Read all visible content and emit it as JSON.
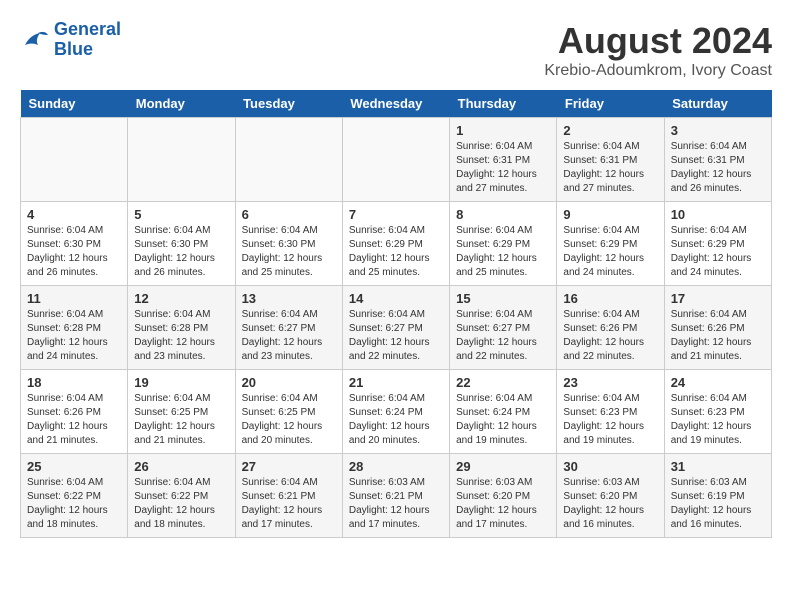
{
  "header": {
    "logo_line1": "General",
    "logo_line2": "Blue",
    "month_year": "August 2024",
    "location": "Krebio-Adoumkrom, Ivory Coast"
  },
  "weekdays": [
    "Sunday",
    "Monday",
    "Tuesday",
    "Wednesday",
    "Thursday",
    "Friday",
    "Saturday"
  ],
  "weeks": [
    [
      {
        "day": "",
        "info": ""
      },
      {
        "day": "",
        "info": ""
      },
      {
        "day": "",
        "info": ""
      },
      {
        "day": "",
        "info": ""
      },
      {
        "day": "1",
        "info": "Sunrise: 6:04 AM\nSunset: 6:31 PM\nDaylight: 12 hours\nand 27 minutes."
      },
      {
        "day": "2",
        "info": "Sunrise: 6:04 AM\nSunset: 6:31 PM\nDaylight: 12 hours\nand 27 minutes."
      },
      {
        "day": "3",
        "info": "Sunrise: 6:04 AM\nSunset: 6:31 PM\nDaylight: 12 hours\nand 26 minutes."
      }
    ],
    [
      {
        "day": "4",
        "info": "Sunrise: 6:04 AM\nSunset: 6:30 PM\nDaylight: 12 hours\nand 26 minutes."
      },
      {
        "day": "5",
        "info": "Sunrise: 6:04 AM\nSunset: 6:30 PM\nDaylight: 12 hours\nand 26 minutes."
      },
      {
        "day": "6",
        "info": "Sunrise: 6:04 AM\nSunset: 6:30 PM\nDaylight: 12 hours\nand 25 minutes."
      },
      {
        "day": "7",
        "info": "Sunrise: 6:04 AM\nSunset: 6:29 PM\nDaylight: 12 hours\nand 25 minutes."
      },
      {
        "day": "8",
        "info": "Sunrise: 6:04 AM\nSunset: 6:29 PM\nDaylight: 12 hours\nand 25 minutes."
      },
      {
        "day": "9",
        "info": "Sunrise: 6:04 AM\nSunset: 6:29 PM\nDaylight: 12 hours\nand 24 minutes."
      },
      {
        "day": "10",
        "info": "Sunrise: 6:04 AM\nSunset: 6:29 PM\nDaylight: 12 hours\nand 24 minutes."
      }
    ],
    [
      {
        "day": "11",
        "info": "Sunrise: 6:04 AM\nSunset: 6:28 PM\nDaylight: 12 hours\nand 24 minutes."
      },
      {
        "day": "12",
        "info": "Sunrise: 6:04 AM\nSunset: 6:28 PM\nDaylight: 12 hours\nand 23 minutes."
      },
      {
        "day": "13",
        "info": "Sunrise: 6:04 AM\nSunset: 6:27 PM\nDaylight: 12 hours\nand 23 minutes."
      },
      {
        "day": "14",
        "info": "Sunrise: 6:04 AM\nSunset: 6:27 PM\nDaylight: 12 hours\nand 22 minutes."
      },
      {
        "day": "15",
        "info": "Sunrise: 6:04 AM\nSunset: 6:27 PM\nDaylight: 12 hours\nand 22 minutes."
      },
      {
        "day": "16",
        "info": "Sunrise: 6:04 AM\nSunset: 6:26 PM\nDaylight: 12 hours\nand 22 minutes."
      },
      {
        "day": "17",
        "info": "Sunrise: 6:04 AM\nSunset: 6:26 PM\nDaylight: 12 hours\nand 21 minutes."
      }
    ],
    [
      {
        "day": "18",
        "info": "Sunrise: 6:04 AM\nSunset: 6:26 PM\nDaylight: 12 hours\nand 21 minutes."
      },
      {
        "day": "19",
        "info": "Sunrise: 6:04 AM\nSunset: 6:25 PM\nDaylight: 12 hours\nand 21 minutes."
      },
      {
        "day": "20",
        "info": "Sunrise: 6:04 AM\nSunset: 6:25 PM\nDaylight: 12 hours\nand 20 minutes."
      },
      {
        "day": "21",
        "info": "Sunrise: 6:04 AM\nSunset: 6:24 PM\nDaylight: 12 hours\nand 20 minutes."
      },
      {
        "day": "22",
        "info": "Sunrise: 6:04 AM\nSunset: 6:24 PM\nDaylight: 12 hours\nand 19 minutes."
      },
      {
        "day": "23",
        "info": "Sunrise: 6:04 AM\nSunset: 6:23 PM\nDaylight: 12 hours\nand 19 minutes."
      },
      {
        "day": "24",
        "info": "Sunrise: 6:04 AM\nSunset: 6:23 PM\nDaylight: 12 hours\nand 19 minutes."
      }
    ],
    [
      {
        "day": "25",
        "info": "Sunrise: 6:04 AM\nSunset: 6:22 PM\nDaylight: 12 hours\nand 18 minutes."
      },
      {
        "day": "26",
        "info": "Sunrise: 6:04 AM\nSunset: 6:22 PM\nDaylight: 12 hours\nand 18 minutes."
      },
      {
        "day": "27",
        "info": "Sunrise: 6:04 AM\nSunset: 6:21 PM\nDaylight: 12 hours\nand 17 minutes."
      },
      {
        "day": "28",
        "info": "Sunrise: 6:03 AM\nSunset: 6:21 PM\nDaylight: 12 hours\nand 17 minutes."
      },
      {
        "day": "29",
        "info": "Sunrise: 6:03 AM\nSunset: 6:20 PM\nDaylight: 12 hours\nand 17 minutes."
      },
      {
        "day": "30",
        "info": "Sunrise: 6:03 AM\nSunset: 6:20 PM\nDaylight: 12 hours\nand 16 minutes."
      },
      {
        "day": "31",
        "info": "Sunrise: 6:03 AM\nSunset: 6:19 PM\nDaylight: 12 hours\nand 16 minutes."
      }
    ]
  ]
}
